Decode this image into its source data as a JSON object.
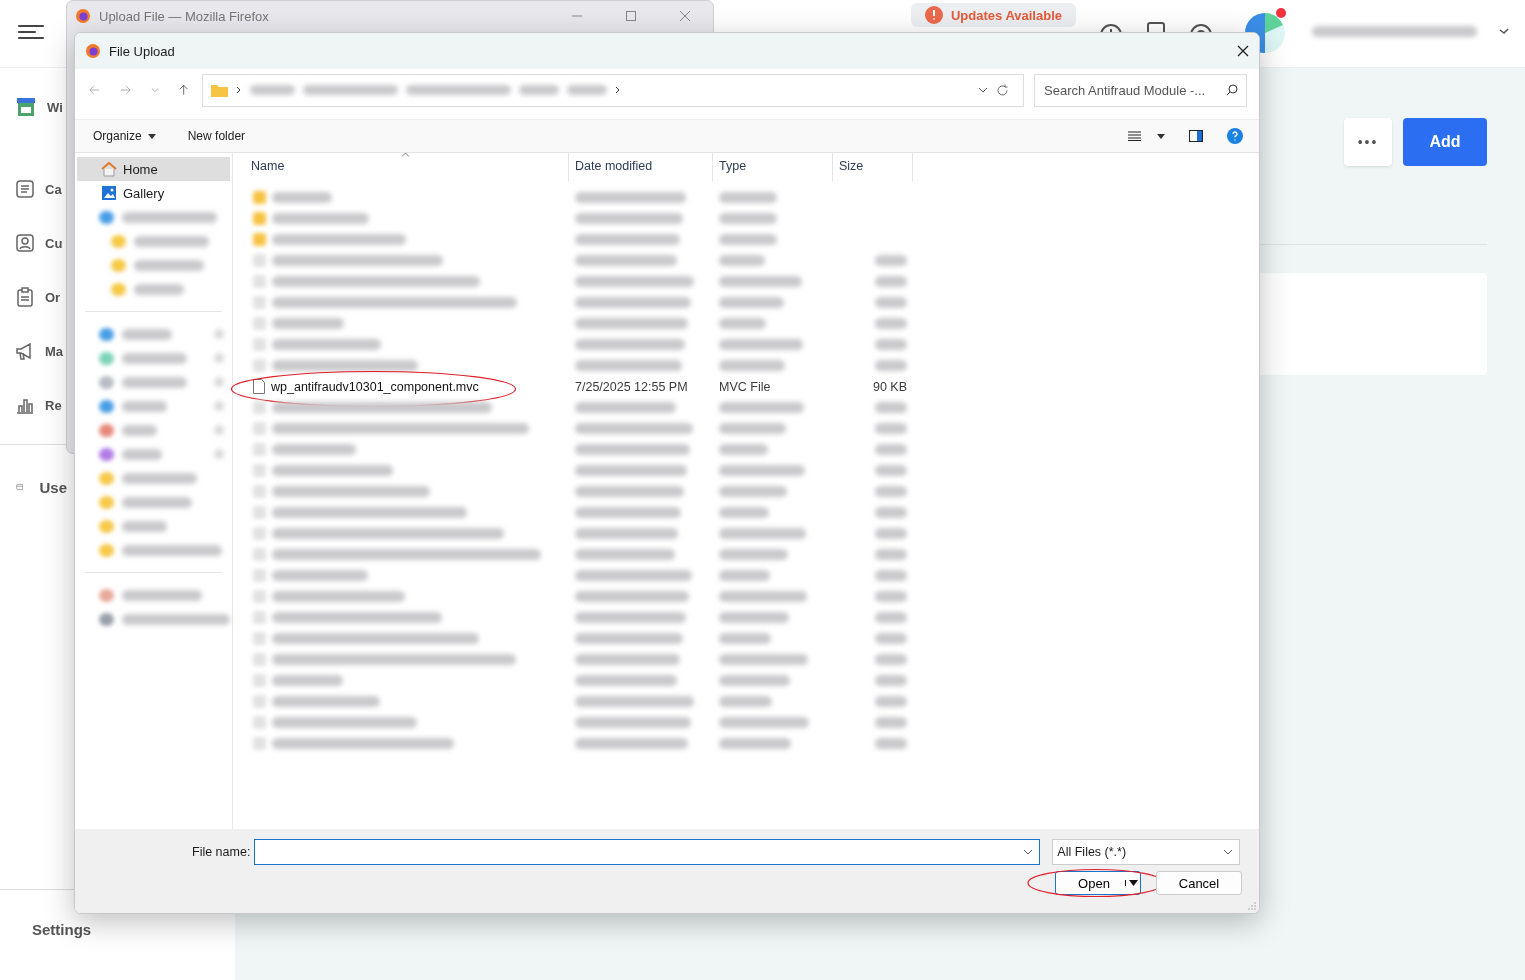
{
  "background_app": {
    "nav_items": [
      {
        "kind": "store",
        "label": "Wi"
      },
      {
        "kind": "list",
        "label": "Ca"
      },
      {
        "kind": "contact",
        "label": "Cu"
      },
      {
        "kind": "clipboard",
        "label": "Or"
      },
      {
        "kind": "megaphone",
        "label": "Ma"
      },
      {
        "kind": "chart",
        "label": "Re"
      },
      {
        "kind": "calendar",
        "label": "Use"
      }
    ],
    "settings_label": "Settings",
    "updates_badge": "Updates Available",
    "more_button": "•••",
    "add_button": "Add"
  },
  "browser_window": {
    "title": "Upload File — Mozilla Firefox"
  },
  "dialog": {
    "title": "File Upload",
    "search": {
      "placeholder": "Search Antifraud Module -..."
    },
    "toolbar": [
      "Organize",
      "New folder"
    ],
    "nav_pane": [
      {
        "kind": "home",
        "label": "Home",
        "selected": true
      },
      {
        "kind": "gallery",
        "label": "Gallery",
        "selected": false
      }
    ],
    "columns": [
      "Name",
      "Date modified",
      "Type",
      "Size"
    ],
    "rows": [
      {
        "kind": "redacted-folder"
      },
      {
        "kind": "redacted-folder"
      },
      {
        "kind": "redacted-folder"
      },
      {
        "kind": "redacted-file"
      },
      {
        "kind": "redacted-file"
      },
      {
        "kind": "redacted-file"
      },
      {
        "kind": "redacted-file"
      },
      {
        "kind": "redacted-file"
      },
      {
        "kind": "redacted-file"
      },
      {
        "kind": "file",
        "name": "wp_antifraudv10301_component.mvc",
        "date": "7/25/2025 12:55 PM",
        "type": "MVC File",
        "size": "90 KB",
        "annotated": true
      },
      {
        "kind": "redacted-file"
      },
      {
        "kind": "redacted-file"
      },
      {
        "kind": "redacted-file"
      },
      {
        "kind": "redacted-file"
      },
      {
        "kind": "redacted-file"
      },
      {
        "kind": "redacted-file"
      },
      {
        "kind": "redacted-file"
      },
      {
        "kind": "redacted-file"
      },
      {
        "kind": "redacted-file"
      },
      {
        "kind": "redacted-file"
      },
      {
        "kind": "redacted-file"
      },
      {
        "kind": "redacted-file"
      },
      {
        "kind": "redacted-file"
      },
      {
        "kind": "redacted-file"
      },
      {
        "kind": "redacted-file"
      },
      {
        "kind": "redacted-file"
      },
      {
        "kind": "redacted-file"
      }
    ],
    "file_name_label": "File name:",
    "filter": "All Files (*.*)",
    "buttons": [
      {
        "label": "Open",
        "default": true,
        "annotated": true
      },
      {
        "label": "Cancel",
        "default": false,
        "annotated": false
      }
    ]
  }
}
